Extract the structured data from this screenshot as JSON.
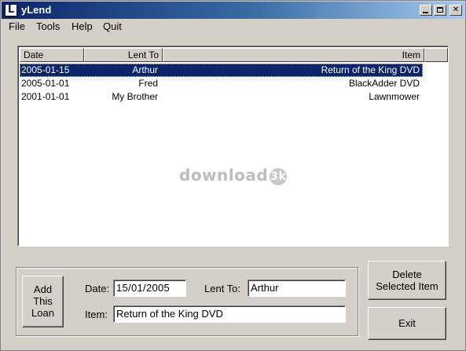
{
  "window": {
    "title": "yLend",
    "icon_letter": "L",
    "controls": {
      "minimize": "",
      "maximize": "",
      "close": "✕"
    }
  },
  "menu": {
    "items": [
      "File",
      "Tools",
      "Help",
      "Quit"
    ]
  },
  "listview": {
    "columns": [
      "Date",
      "Lent To",
      "Item"
    ],
    "rows": [
      {
        "date": "2005-01-15",
        "lent_to": "Arthur",
        "item": "Return of the King DVD",
        "selected": true
      },
      {
        "date": "2005-01-01",
        "lent_to": "Fred",
        "item": "BlackAdder DVD",
        "selected": false
      },
      {
        "date": "2001-01-01",
        "lent_to": "My Brother",
        "item": "Lawnmower",
        "selected": false
      }
    ]
  },
  "watermark": {
    "text": "download",
    "badge": "3k"
  },
  "form": {
    "add_button_lines": [
      "Add",
      "This",
      "Loan"
    ],
    "date_label": "Date:",
    "date_value": "15/01/2005",
    "lent_to_label": "Lent To:",
    "lent_to_value": "Arthur",
    "item_label": "Item:",
    "item_value": "Return of the King DVD"
  },
  "actions": {
    "delete_lines": [
      "Delete",
      "Selected Item"
    ],
    "exit_label": "Exit"
  },
  "colors": {
    "titlebar_start": "#0a246a",
    "selection": "#0a246a",
    "face": "#d4d0c8"
  }
}
